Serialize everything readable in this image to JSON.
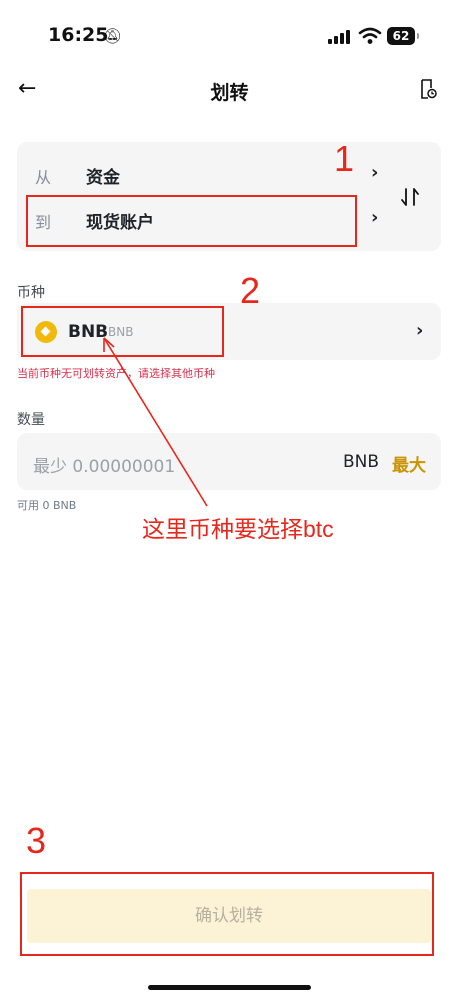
{
  "status_bar": {
    "time": "16:25",
    "battery": "62"
  },
  "header": {
    "title": "划转"
  },
  "transfer": {
    "from_label": "从",
    "from_value": "资金",
    "to_label": "到",
    "to_value": "现货账户"
  },
  "currency": {
    "section_label": "币种",
    "symbol": "BNB",
    "sub": "BNB",
    "warning": "当前币种无可划转资产，请选择其他币种"
  },
  "amount": {
    "section_label": "数量",
    "placeholder": "最少 0.00000001",
    "unit": "BNB",
    "max_label": "最大",
    "available": "可用 0 BNB"
  },
  "confirm_label": "确认划转",
  "annotations": {
    "n1": "1",
    "n2": "2",
    "n3": "3",
    "note": "这里币种要选择btc",
    "color": "#e8271c"
  },
  "colors": {
    "accent": "#f0b90b",
    "max_text": "#c99400",
    "warning": "#d9304e",
    "confirm_bg": "#fcf3d6"
  }
}
